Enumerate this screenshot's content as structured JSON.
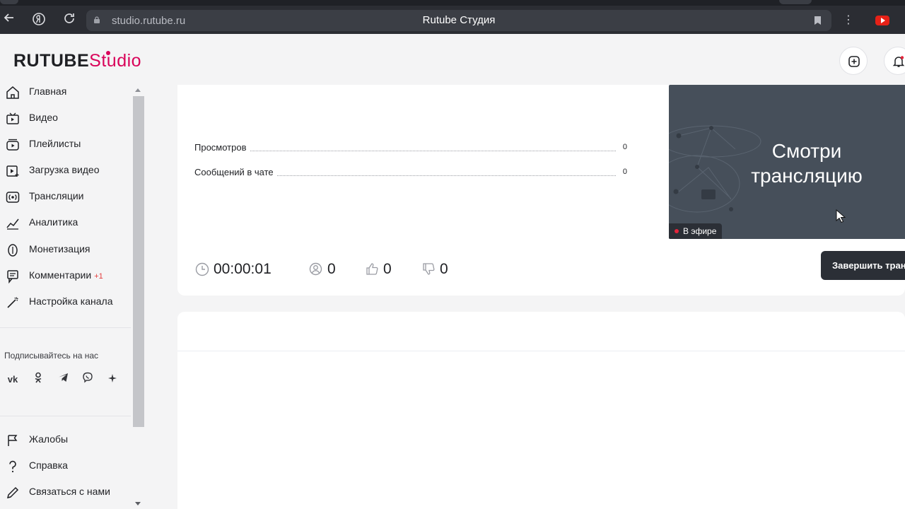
{
  "browser": {
    "url": "studio.rutube.ru",
    "page_title": "Rutube Студия"
  },
  "header": {
    "logo_main": "RUTUBE",
    "logo_sub": "Studio"
  },
  "sidebar": {
    "items": [
      {
        "label": "Главная",
        "icon": "home-icon"
      },
      {
        "label": "Видео",
        "icon": "video-icon"
      },
      {
        "label": "Плейлисты",
        "icon": "playlist-icon"
      },
      {
        "label": "Загрузка видео",
        "icon": "upload-video-icon"
      },
      {
        "label": "Трансляции",
        "icon": "broadcast-icon"
      },
      {
        "label": "Аналитика",
        "icon": "analytics-icon"
      },
      {
        "label": "Монетизация",
        "icon": "monetization-icon"
      },
      {
        "label": "Комментарии",
        "icon": "comments-icon",
        "badge": "+1"
      },
      {
        "label": "Настройка канала",
        "icon": "channel-settings-icon"
      }
    ],
    "follow_title": "Подписывайтесь на нас",
    "socials": [
      "vk-icon",
      "odnoklassniki-icon",
      "telegram-icon",
      "viber-icon",
      "more-icon"
    ],
    "bottom_items": [
      {
        "label": "Жалобы",
        "icon": "flag-icon"
      },
      {
        "label": "Справка",
        "icon": "help-icon"
      },
      {
        "label": "Связаться с нами",
        "icon": "contact-icon"
      }
    ]
  },
  "stats": {
    "views_label": "Просмотров",
    "views_value": "0",
    "chat_label": "Сообщений в чате",
    "chat_value": "0"
  },
  "metrics": {
    "duration": "00:00:01",
    "viewers": "0",
    "likes": "0",
    "dislikes": "0"
  },
  "preview": {
    "text": "Смотри трансляцию",
    "live_label": "В эфире"
  },
  "actions": {
    "end_stream": "Завершить транс"
  },
  "colors": {
    "brand": "#d9045a",
    "live_dot": "#e3243b",
    "badge": "#e33b3b"
  }
}
